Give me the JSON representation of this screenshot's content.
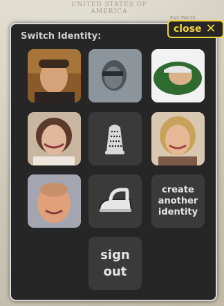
{
  "map": {
    "country_label": "UNITED STATES OF AMERICA",
    "city_label": "Fort Worth"
  },
  "panel": {
    "title": "Switch Identity:",
    "close_label": "close"
  },
  "identities": [
    {
      "type": "photo",
      "icon": "person-photo-man-1"
    },
    {
      "type": "photo",
      "icon": "person-photo-woman-grey"
    },
    {
      "type": "photo",
      "icon": "person-photo-man-cap"
    },
    {
      "type": "photo",
      "icon": "person-photo-woman-smiling"
    },
    {
      "type": "icon",
      "icon": "thimble-icon"
    },
    {
      "type": "photo",
      "icon": "person-photo-woman-blonde"
    },
    {
      "type": "photo",
      "icon": "person-photo-man-bald"
    },
    {
      "type": "icon",
      "icon": "iron-icon"
    }
  ],
  "actions": {
    "create_label": "create another identity",
    "signout_label": "sign out"
  },
  "colors": {
    "panel_bg": "#262626",
    "panel_border": "#d9d9d9",
    "tile_bg": "#3a3a3a",
    "close_accent": "#f2d43a"
  }
}
